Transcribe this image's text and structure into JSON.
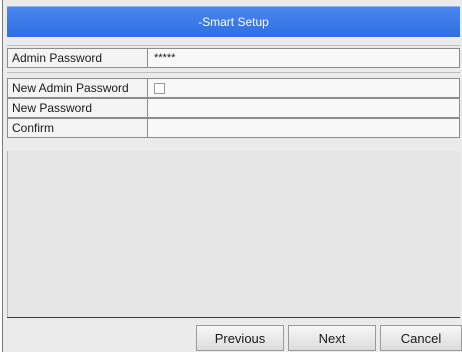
{
  "window": {
    "title": "-Smart Setup"
  },
  "form": {
    "admin_password": {
      "label": "Admin Password",
      "value": "*****"
    },
    "new_admin_password": {
      "label": "New Admin Password",
      "checked": false
    },
    "new_password": {
      "label": "New Password",
      "value": ""
    },
    "confirm": {
      "label": "Confirm",
      "value": ""
    }
  },
  "buttons": {
    "previous": "Previous",
    "next": "Next",
    "cancel": "Cancel"
  }
}
